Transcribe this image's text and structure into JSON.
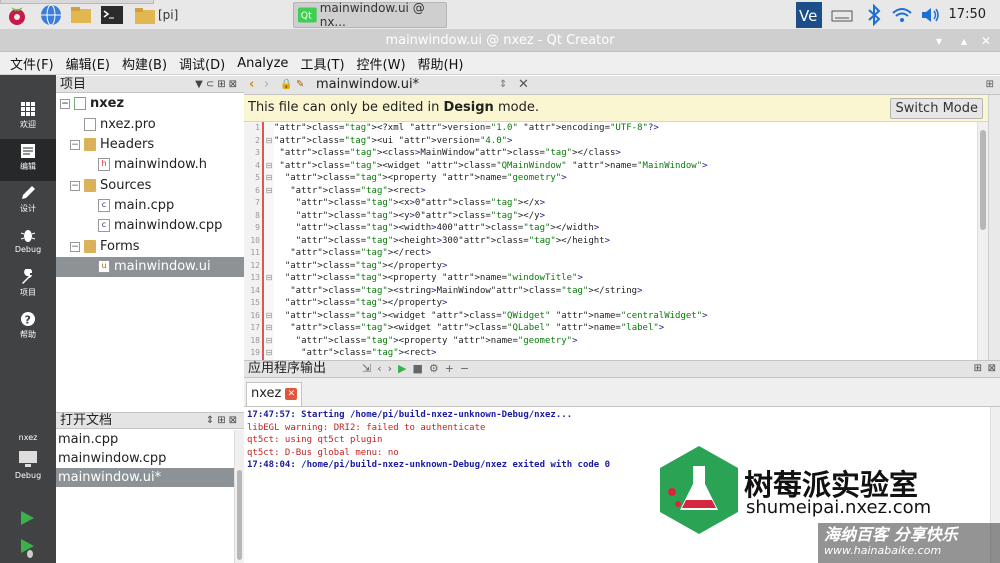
{
  "taskbar": {
    "tasks": [
      {
        "label": "[pi]"
      },
      {
        "label": "mainwindow.ui @ nx..."
      }
    ],
    "clock": "17:50"
  },
  "window": {
    "title": "mainwindow.ui @ nxez - Qt Creator",
    "min_glyph": "▾",
    "max_glyph": "▴",
    "close_glyph": "✕"
  },
  "menubar": {
    "items": [
      "文件(F)",
      "编辑(E)",
      "构建(B)",
      "调试(D)",
      "Analyze",
      "工具(T)",
      "控件(W)",
      "帮助(H)"
    ]
  },
  "modes": [
    {
      "label": "欢迎",
      "icon": "grid-icon"
    },
    {
      "label": "编辑",
      "icon": "edit-document-icon"
    },
    {
      "label": "设计",
      "icon": "pencil-icon"
    },
    {
      "label": "Debug",
      "icon": "bug-icon"
    },
    {
      "label": "项目",
      "icon": "wrench-icon"
    },
    {
      "label": "帮助",
      "icon": "help-icon"
    }
  ],
  "kit": {
    "project": "nxez",
    "mode": "Debug"
  },
  "project_panel": {
    "title": "项目",
    "tree": [
      {
        "label": "nxez",
        "level": 0,
        "type": "root"
      },
      {
        "label": "nxez.pro",
        "level": 1,
        "type": "pro"
      },
      {
        "label": "Headers",
        "level": 1,
        "type": "folder"
      },
      {
        "label": "mainwindow.h",
        "level": 2,
        "type": "h"
      },
      {
        "label": "Sources",
        "level": 1,
        "type": "folder"
      },
      {
        "label": "main.cpp",
        "level": 2,
        "type": "cpp"
      },
      {
        "label": "mainwindow.cpp",
        "level": 2,
        "type": "cpp"
      },
      {
        "label": "Forms",
        "level": 1,
        "type": "folder"
      },
      {
        "label": "mainwindow.ui",
        "level": 2,
        "type": "ui",
        "selected": true
      }
    ]
  },
  "open_docs": {
    "title": "打开文档",
    "items": [
      "main.cpp",
      "mainwindow.cpp",
      "mainwindow.ui*"
    ],
    "selected": 2
  },
  "editor": {
    "file_tab": "mainwindow.ui*",
    "info_text_pre": "This file can only be edited in ",
    "info_text_bold": "Design",
    "info_text_post": " mode.",
    "switch_mode": "Switch Mode",
    "lines": [
      "<?xml version=\"1.0\" encoding=\"UTF-8\"?>",
      "<ui version=\"4.0\">",
      " <class>MainWindow</class>",
      " <widget class=\"QMainWindow\" name=\"MainWindow\">",
      "  <property name=\"geometry\">",
      "   <rect>",
      "    <x>0</x>",
      "    <y>0</y>",
      "    <width>400</width>",
      "    <height>300</height>",
      "   </rect>",
      "  </property>",
      "  <property name=\"windowTitle\">",
      "   <string>MainWindow</string>",
      "  </property>",
      "  <widget class=\"QWidget\" name=\"centralWidget\">",
      "   <widget class=\"QLabel\" name=\"label\">",
      "    <property name=\"geometry\">",
      "     <rect>"
    ]
  },
  "output": {
    "title": "应用程序输出",
    "tab": "nxez",
    "lines": [
      {
        "text": "17:47:57: Starting /home/pi/build-nxez-unknown-Debug/nxez...",
        "kind": "blue"
      },
      {
        "text": "libEGL warning: DRI2: failed to authenticate",
        "kind": "red"
      },
      {
        "text": "qt5ct: using qt5ct plugin",
        "kind": "red"
      },
      {
        "text": "qt5ct: D-Bus global menu: no",
        "kind": "red"
      },
      {
        "text": "17:48:04: /home/pi/build-nxez-unknown-Debug/nxez exited with code 0",
        "kind": "blue"
      }
    ]
  },
  "watermark": {
    "cn": "树莓派实验室",
    "url": "shumeipai.nxez.com",
    "bottom_cn": "海纳百客 分享快乐",
    "bottom_url": "www.hainabaike.com"
  }
}
